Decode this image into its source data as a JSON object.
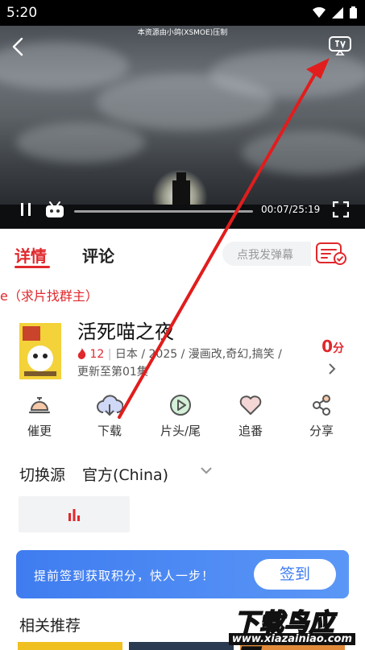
{
  "status_bar": {
    "time": "5:20"
  },
  "player": {
    "top_caption": "本资源由小鸽(XSMOE)压制",
    "time": "00:07/25:19"
  },
  "tabs": {
    "detail": "详情",
    "comments": "评论"
  },
  "danmaku": {
    "placeholder": "点我发弹幕"
  },
  "marquee": "e（求片找群主）",
  "anime": {
    "title": "活死喵之夜",
    "heat": "12",
    "meta": "日本 / 2025 / 漫画改,奇幻,搞笑 /",
    "update": "更新至第01集",
    "score": "0",
    "score_unit": "分"
  },
  "actions": [
    {
      "label": "催更",
      "icon": "bell-icon"
    },
    {
      "label": "下载",
      "icon": "cloud-download-icon"
    },
    {
      "label": "片头/尾",
      "icon": "play-circle-icon"
    },
    {
      "label": "追番",
      "icon": "heart-icon"
    },
    {
      "label": "分享",
      "icon": "share-icon"
    }
  ],
  "source": {
    "label": "切换源",
    "value": "官方(China)"
  },
  "checkin": {
    "text": "提前签到获取积分，快人一步！",
    "button": "签到"
  },
  "related": {
    "title": "相关推荐"
  },
  "watermark": {
    "brand": "下载鸟应用",
    "url": "www.xiazainiao.com"
  },
  "colors": {
    "accent": "#e0282d",
    "checkin": "#3f7cf0"
  }
}
